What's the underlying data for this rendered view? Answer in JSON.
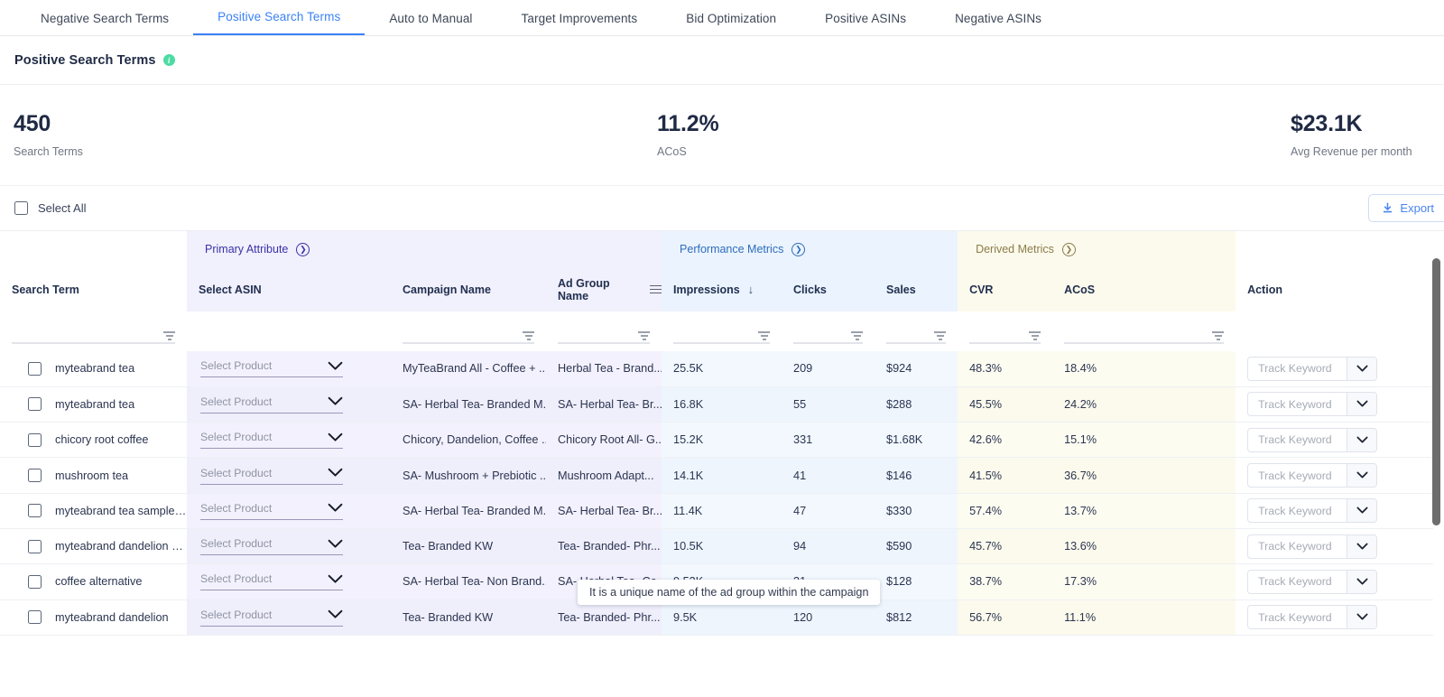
{
  "tabs": [
    {
      "label": "Negative Search Terms",
      "active": false
    },
    {
      "label": "Positive Search Terms",
      "active": true
    },
    {
      "label": "Auto to Manual",
      "active": false
    },
    {
      "label": "Target Improvements",
      "active": false
    },
    {
      "label": "Bid Optimization",
      "active": false
    },
    {
      "label": "Positive ASINs",
      "active": false
    },
    {
      "label": "Negative ASINs",
      "active": false
    }
  ],
  "page": {
    "title": "Positive Search Terms",
    "info_icon": "i"
  },
  "stats": [
    {
      "value": "450",
      "label": "Search Terms"
    },
    {
      "value": "11.2%",
      "label": "ACoS"
    },
    {
      "value": "$23.1K",
      "label": "Avg Revenue per month"
    }
  ],
  "toolbar": {
    "select_all_label": "Select All",
    "export_label": "Export"
  },
  "groups": [
    {
      "label": "Primary Attribute",
      "theme": "primary"
    },
    {
      "label": "Performance Metrics",
      "theme": "perf"
    },
    {
      "label": "Derived Metrics",
      "theme": "derived"
    }
  ],
  "columns": {
    "search_term": "Search Term",
    "select_asin": "Select ASIN",
    "campaign_name": "Campaign Name",
    "ad_group_name": "Ad Group Name",
    "impressions": "Impressions",
    "clicks": "Clicks",
    "sales": "Sales",
    "cvr": "CVR",
    "acos": "ACoS",
    "action": "Action"
  },
  "sort": {
    "column": "Impressions",
    "direction": "desc",
    "glyph": "↓"
  },
  "tooltip": {
    "text": "It is a unique name of the ad group within the campaign"
  },
  "controls": {
    "select_product_placeholder": "Select Product",
    "track_keyword_placeholder": "Track Keyword"
  },
  "rows": [
    {
      "search_term": "myteabrand tea",
      "select_asin": "Select Product",
      "campaign_name": "MyTeaBrand All - Coffee + ...",
      "ad_group_name": "Herbal Tea - Brand...",
      "impressions": "25.5K",
      "clicks": "209",
      "sales": "$924",
      "cvr": "48.3%",
      "acos": "18.4%",
      "action": "Track Keyword"
    },
    {
      "search_term": "myteabrand tea",
      "select_asin": "Select Product",
      "campaign_name": "SA- Herbal Tea- Branded M...",
      "ad_group_name": "SA- Herbal Tea- Br...",
      "impressions": "16.8K",
      "clicks": "55",
      "sales": "$288",
      "cvr": "45.5%",
      "acos": "24.2%",
      "action": "Track Keyword"
    },
    {
      "search_term": "chicory root coffee",
      "select_asin": "Select Product",
      "campaign_name": "Chicory, Dandelion, Coffee ...",
      "ad_group_name": "Chicory Root All- G...",
      "impressions": "15.2K",
      "clicks": "331",
      "sales": "$1.68K",
      "cvr": "42.6%",
      "acos": "15.1%",
      "action": "Track Keyword"
    },
    {
      "search_term": "mushroom tea",
      "select_asin": "Select Product",
      "campaign_name": "SA- Mushroom + Prebiotic ...",
      "ad_group_name": "Mushroom Adapt...",
      "impressions": "14.1K",
      "clicks": "41",
      "sales": "$146",
      "cvr": "41.5%",
      "acos": "36.7%",
      "action": "Track Keyword"
    },
    {
      "search_term": "myteabrand tea sampler...",
      "select_asin": "Select Product",
      "campaign_name": "SA- Herbal Tea- Branded M...",
      "ad_group_name": "SA- Herbal Tea- Br...",
      "impressions": "11.4K",
      "clicks": "47",
      "sales": "$330",
      "cvr": "57.4%",
      "acos": "13.7%",
      "action": "Track Keyword"
    },
    {
      "search_term": "myteabrand dandelion d...",
      "select_asin": "Select Product",
      "campaign_name": "Tea- Branded KW",
      "ad_group_name": "Tea- Branded- Phr...",
      "impressions": "10.5K",
      "clicks": "94",
      "sales": "$590",
      "cvr": "45.7%",
      "acos": "13.6%",
      "action": "Track Keyword"
    },
    {
      "search_term": "coffee alternative",
      "select_asin": "Select Product",
      "campaign_name": "SA- Herbal Tea- Non Brand...",
      "ad_group_name": "SA- Herbal Tea- Co...",
      "impressions": "9.53K",
      "clicks": "31",
      "sales": "$128",
      "cvr": "38.7%",
      "acos": "17.3%",
      "action": "Track Keyword"
    },
    {
      "search_term": "myteabrand dandelion",
      "select_asin": "Select Product",
      "campaign_name": "Tea- Branded KW",
      "ad_group_name": "Tea- Branded- Phr...",
      "impressions": "9.5K",
      "clicks": "120",
      "sales": "$812",
      "cvr": "56.7%",
      "acos": "11.1%",
      "action": "Track Keyword"
    }
  ],
  "colors": {
    "accent": "#3b82f6",
    "primary_group_bg": "#f1f0fd",
    "perf_group_bg": "#eaf3fe",
    "derived_group_bg": "#fcfaec",
    "info_dot": "#4ddba4",
    "text": "#1f2a44"
  }
}
